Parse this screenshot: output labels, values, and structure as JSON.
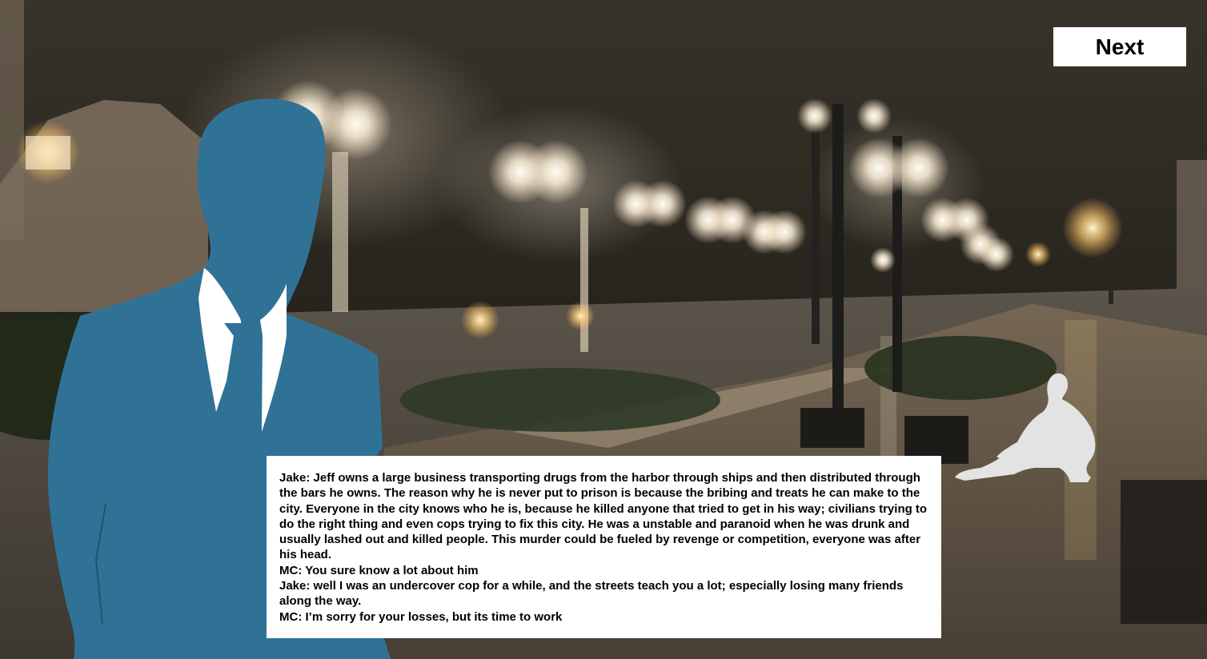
{
  "controls": {
    "next_label": "Next"
  },
  "characters": {
    "speaker_left": "businessman-silhouette",
    "figure_right": "sitting-figure-silhouette"
  },
  "colors": {
    "speaker_silhouette": "#2f7296",
    "sitting_figure": "#e3e3e3",
    "dialogue_bg": "#ffffff"
  },
  "dialogue": {
    "lines": [
      "Jake: Jeff owns a large business transporting drugs from the harbor through ships and then distributed through the bars he owns. The reason why he is never put to prison is because the bribing and treats he can make to the city. Everyone in the city knows who he is, because he killed anyone that tried to get in his way; civilians trying to do the right thing and even cops trying to fix this city. He was a unstable and paranoid when he was drunk and usually lashed out and killed people. This murder could be fueled by revenge or competition, everyone was after his head.",
      "MC: You sure know a lot about him",
      "Jake: well I was an undercover cop for a while, and the streets teach you a lot; especially losing many friends along the way.",
      "MC: I’m sorry for your losses, but its time to work"
    ]
  }
}
